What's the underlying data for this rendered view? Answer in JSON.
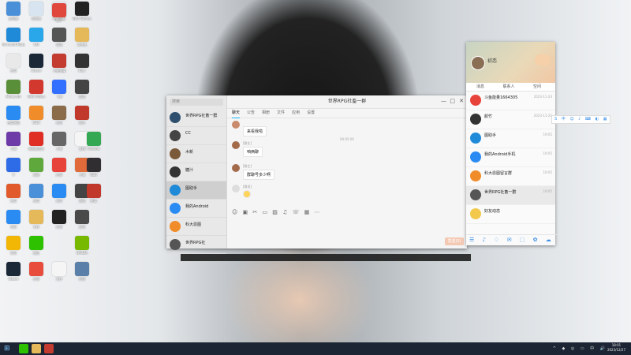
{
  "desktop": {
    "icons": [
      {
        "label": "此电脑",
        "color": "#4a90d9",
        "col": 0,
        "row": 0
      },
      {
        "label": "回收站",
        "color": "#d8e4ef",
        "col": 1,
        "row": 0
      },
      {
        "label": "控制面板",
        "color": "#e8f1f8",
        "col": 2,
        "row": 0
      },
      {
        "label": "图片",
        "color": "#e0483e",
        "col": 2,
        "row": 0.05
      },
      {
        "label": "Epic Games",
        "color": "#222222",
        "col": 3,
        "row": 0
      },
      {
        "label": "Microsoft Edge",
        "color": "#1f8ad8",
        "col": 0,
        "row": 1
      },
      {
        "label": "QQ",
        "color": "#2aa6ea",
        "col": 1,
        "row": 1
      },
      {
        "label": "游戏",
        "color": "#555555",
        "col": 2,
        "row": 1
      },
      {
        "label": "文件夹",
        "color": "#e5b85a",
        "col": 3,
        "row": 1
      },
      {
        "label": "应用",
        "color": "#e9e9e9",
        "col": 0,
        "row": 2
      },
      {
        "label": "Steam",
        "color": "#1b2838",
        "col": 1,
        "row": 2
      },
      {
        "label": "王者荣耀",
        "color": "#c43b30",
        "col": 2,
        "row": 2
      },
      {
        "label": "Epic",
        "color": "#333333",
        "col": 3,
        "row": 2
      },
      {
        "label": "Minecraft",
        "color": "#5a8f3a",
        "col": 0,
        "row": 3
      },
      {
        "label": "WPS Office",
        "color": "#d3382f",
        "col": 1,
        "row": 3
      },
      {
        "label": "飞书",
        "color": "#3370ff",
        "col": 2,
        "row": 3
      },
      {
        "label": "游戏",
        "color": "#444444",
        "col": 3,
        "row": 3
      },
      {
        "label": "百度网盘",
        "color": "#2a8bf2",
        "col": 0,
        "row": 4
      },
      {
        "label": "IDEA",
        "color": "#f08c2a",
        "col": 1,
        "row": 4
      },
      {
        "label": "应用",
        "color": "#8a6b4a",
        "col": 2,
        "row": 4
      },
      {
        "label": "软件",
        "color": "#c0392b",
        "col": 3,
        "row": 4
      },
      {
        "label": "工具",
        "color": "#6d3aa8",
        "col": 0,
        "row": 5
      },
      {
        "label": "网易云音乐",
        "color": "#e02e24",
        "col": 1,
        "row": 5
      },
      {
        "label": "工具",
        "color": "#666666",
        "col": 2,
        "row": 5
      },
      {
        "label": "文档",
        "color": "#f5f5f5",
        "col": 3,
        "row": 5
      },
      {
        "label": "Chrome",
        "color": "#34a853",
        "col": 3.5,
        "row": 5
      },
      {
        "label": "X",
        "color": "#2e6be6",
        "col": 0,
        "row": 6
      },
      {
        "label": "游戏",
        "color": "#5fa83b",
        "col": 1,
        "row": 6
      },
      {
        "label": "应用",
        "color": "#e8433a",
        "col": 2,
        "row": 6
      },
      {
        "label": "工具",
        "color": "#e06a3a",
        "col": 3,
        "row": 6
      },
      {
        "label": "OBS",
        "color": "#302e31",
        "col": 3.5,
        "row": 6
      },
      {
        "label": "应用",
        "color": "#e05a2c",
        "col": 0,
        "row": 7
      },
      {
        "label": "应用",
        "color": "#4a90d9",
        "col": 1,
        "row": 7
      },
      {
        "label": "应用",
        "color": "#2a8bf2",
        "col": 2,
        "row": 7
      },
      {
        "label": "游戏",
        "color": "#444444",
        "col": 3,
        "row": 7
      },
      {
        "label": "应用",
        "color": "#c0392b",
        "col": 3.5,
        "row": 7
      },
      {
        "label": "应用",
        "color": "#2a8bf2",
        "col": 0,
        "row": 8
      },
      {
        "label": "文件",
        "color": "#e5b85a",
        "col": 1,
        "row": 8
      },
      {
        "label": "应用",
        "color": "#222222",
        "col": 2,
        "row": 8
      },
      {
        "label": "应用",
        "color": "#4a4a4a",
        "col": 3,
        "row": 8
      },
      {
        "label": "应用",
        "color": "#f2b705",
        "col": 0,
        "row": 9
      },
      {
        "label": "微信",
        "color": "#2dc100",
        "col": 1,
        "row": 9
      },
      {
        "label": "NVIDIA",
        "color": "#76b900",
        "col": 3,
        "row": 9
      },
      {
        "label": "Steam",
        "color": "#1b2838",
        "col": 0,
        "row": 10
      },
      {
        "label": "应用",
        "color": "#e74c3c",
        "col": 1,
        "row": 10
      },
      {
        "label": "文件",
        "color": "#f5f5f5",
        "col": 2,
        "row": 10
      },
      {
        "label": "应用",
        "color": "#5a7fa8",
        "col": 3,
        "row": 10
      }
    ]
  },
  "chat_window": {
    "title": "世界RPG社畜一群",
    "search_placeholder": "搜索",
    "list": [
      {
        "name": "世界RPG社畜一群",
        "preview": "",
        "time": "",
        "color": "#2f4f6f"
      },
      {
        "name": "CC",
        "preview": "",
        "time": "",
        "color": "#444444"
      },
      {
        "name": "木新",
        "preview": "",
        "time": "",
        "color": "#7a5a3a"
      },
      {
        "name": "糖汁",
        "preview": "",
        "time": "",
        "color": "#333333"
      },
      {
        "name": "图助手",
        "preview": "",
        "time": "",
        "color": "#1f8ad8"
      },
      {
        "name": "我的Android",
        "preview": "",
        "time": "",
        "color": "#2a8bf2"
      },
      {
        "name": "科大恩图",
        "preview": "",
        "time": "",
        "color": "#f08c2a"
      },
      {
        "name": "世界RPG社",
        "preview": "",
        "time": "",
        "color": "#555555"
      }
    ],
    "tabs": [
      "聊天",
      "公告",
      "相册",
      "文件",
      "应用",
      "设置"
    ],
    "timestamp": "09:05:00",
    "messages": [
      {
        "meta": "",
        "text": "来看我啦"
      },
      {
        "meta": "[群主]",
        "text": "咱俩聊"
      },
      {
        "meta": "[群主]",
        "text": "群聊号多少啊"
      },
      {
        "meta": "[群员]",
        "text": ""
      }
    ],
    "send_label": "发送(S)",
    "toolbar_icons": [
      "emoji-icon",
      "gif-icon",
      "scissors-icon",
      "folder-icon",
      "image-icon",
      "music-icon",
      "phone-icon",
      "screenshot-icon",
      "more-icon"
    ]
  },
  "statusbar": {
    "text": ""
  },
  "qq_panel": {
    "nickname": "初恋",
    "tabs": [
      "消息",
      "联系人",
      "空间"
    ],
    "items": [
      {
        "name": "斗鱼能量1664305",
        "preview": "",
        "time": "2023-11-24",
        "color": "#e8433a"
      },
      {
        "name": "颜竹",
        "preview": "",
        "time": "2023-11-21",
        "color": "#333333"
      },
      {
        "name": "图助手",
        "preview": "",
        "time": "19:05",
        "color": "#1f8ad8"
      },
      {
        "name": "我的Android手机",
        "preview": "",
        "time": "19:05",
        "color": "#2a8bf2"
      },
      {
        "name": "科大恩图留言群",
        "preview": "",
        "time": "19:05",
        "color": "#f08c2a"
      },
      {
        "name": "世界RPG社畜一群",
        "preview": "",
        "time": "19:05",
        "color": "#555555"
      },
      {
        "name": "好友动态",
        "preview": "",
        "time": "",
        "color": "#f2c94c"
      }
    ]
  },
  "ime_bar": {
    "icons": [
      "sogou-icon",
      "chinese-mode-icon",
      "emoji-icon",
      "mic-icon",
      "keyboard-icon",
      "skin-icon",
      "tools-icon"
    ]
  },
  "taskbar": {
    "apps": [
      {
        "name": "windows-start",
        "color": "#7cc4ff"
      },
      {
        "name": "qq-app",
        "color": "#2dc100"
      },
      {
        "name": "file-explorer",
        "color": "#e5b85a"
      },
      {
        "name": "other-app",
        "color": "#c43b30"
      }
    ],
    "time": "18:01",
    "date": "2023/12/27"
  }
}
